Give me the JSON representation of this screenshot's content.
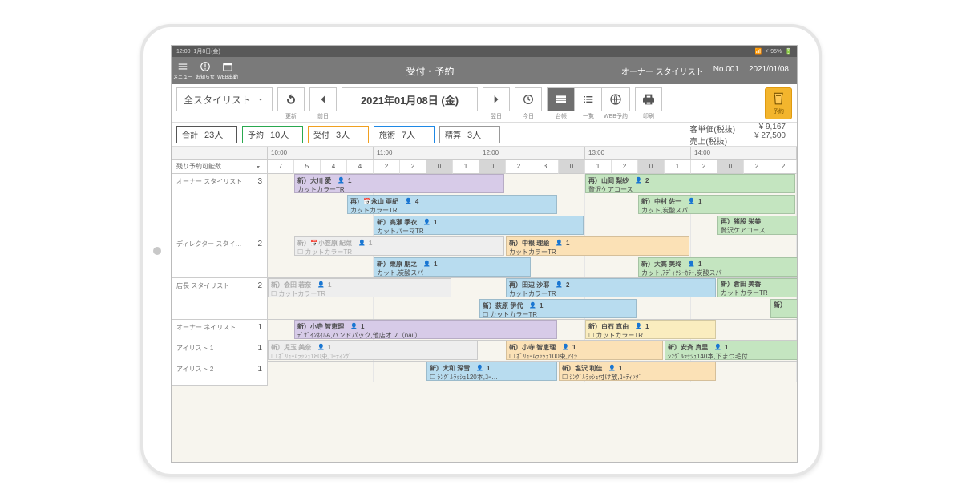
{
  "status": {
    "time": "12:00",
    "date": "1月8日(金)",
    "battery": "95%"
  },
  "appbar": {
    "menu": "メニュー",
    "notice": "お知らせ",
    "cal": "WEB出勤",
    "title": "受付・予約",
    "role": "オーナー スタイリスト",
    "no": "No.001",
    "date2": "2021/01/08"
  },
  "toolbar": {
    "stylist": "全スタイリスト",
    "refresh": "更新",
    "prev": "前日",
    "date": "2021年01月08日 (金)",
    "next": "翌日",
    "today": "今日",
    "ledger": "台帳",
    "list": "一覧",
    "web": "WEB予約",
    "print": "印刷",
    "reserve": "予約"
  },
  "stats": {
    "total_l": "合計",
    "total_v": "23人",
    "reserve_l": "予約",
    "reserve_v": "10人",
    "recep_l": "受付",
    "recep_v": "3人",
    "treat_l": "施術",
    "treat_v": "7人",
    "settle_l": "精算",
    "settle_v": "3人"
  },
  "sales": {
    "unit_l": "客単価(税抜)",
    "unit_v": "¥ 9,167",
    "sales_l": "売上(税抜)",
    "sales_v": "¥ 27,500"
  },
  "hours": [
    "10:00",
    "11:00",
    "12:00",
    "13:00",
    "14:00"
  ],
  "avail": {
    "label": "残り予約可能数",
    "nums": [
      "7",
      "5",
      "4",
      "4",
      "2",
      "2",
      "0",
      "1",
      "0",
      "2",
      "3",
      "0",
      "1",
      "2",
      "0",
      "1",
      "2",
      "0",
      "2",
      "2"
    ]
  },
  "staff": [
    {
      "name": "オーナー スタイリスト",
      "count": "3"
    },
    {
      "name": "ディレクター スタイ…",
      "count": "2"
    },
    {
      "name": "店長 スタイリスト",
      "count": "2"
    },
    {
      "name": "オーナー ネイリスト",
      "count": "1"
    },
    {
      "name": "アイリスト 1",
      "count": "1"
    },
    {
      "name": "アイリスト 2",
      "count": "1"
    }
  ],
  "appts": [
    {
      "staff": 0,
      "sub": 0,
      "start": 0.25,
      "dur": 2.0,
      "c": "purple",
      "tag": "新）",
      "name": "大川 愛",
      "p": "1",
      "svc": "カットカラーTR"
    },
    {
      "staff": 0,
      "sub": 0,
      "start": 3.0,
      "dur": 2.0,
      "c": "green",
      "tag": "再）",
      "name": "山岡 梨紗",
      "p": "2",
      "svc": "贅沢ケアコース"
    },
    {
      "staff": 0,
      "sub": 1,
      "start": 0.75,
      "dur": 2.0,
      "c": "blue",
      "tag": "再）📅",
      "name": "永山 亜紀",
      "p": "4",
      "svc": "カットカラーTR"
    },
    {
      "staff": 0,
      "sub": 1,
      "start": 3.5,
      "dur": 1.5,
      "c": "green",
      "tag": "新）",
      "name": "中村 佐一",
      "p": "1",
      "svc": "カット,炭酸スパ"
    },
    {
      "staff": 0,
      "sub": 2,
      "start": 1.0,
      "dur": 2.0,
      "c": "blue",
      "tag": "新）",
      "name": "高瀬 季衣",
      "p": "1",
      "svc": "カットパーマTR"
    },
    {
      "staff": 0,
      "sub": 2,
      "start": 4.25,
      "dur": 1.0,
      "c": "green",
      "tag": "再）",
      "name": "猪股 栄美",
      "p": "",
      "svc": "贅沢ケアコース"
    },
    {
      "staff": 1,
      "sub": 0,
      "start": 0.25,
      "dur": 2.0,
      "c": "gray",
      "tag": "新）📅",
      "name": "小笠原 紀菜",
      "p": "1",
      "svc": "☐ カットカラーTR"
    },
    {
      "staff": 1,
      "sub": 0,
      "start": 2.25,
      "dur": 1.75,
      "c": "orange",
      "tag": "新）",
      "name": "中根 理絵",
      "p": "1",
      "svc": "カットカラーTR"
    },
    {
      "staff": 1,
      "sub": 1,
      "start": 1.0,
      "dur": 1.5,
      "c": "blue",
      "tag": "新）",
      "name": "栗原 朋之",
      "p": "1",
      "svc": "カット,炭酸スパ"
    },
    {
      "staff": 1,
      "sub": 1,
      "start": 3.5,
      "dur": 1.75,
      "c": "green",
      "tag": "新）",
      "name": "大高 美玲",
      "p": "1",
      "svc": "カット,ｱﾃﾞｨｸｼｰｶﾗｰ,炭酸スパ"
    },
    {
      "staff": 2,
      "sub": 0,
      "start": 0.0,
      "dur": 1.75,
      "c": "gray",
      "tag": "新）",
      "name": "会田 若奈",
      "p": "1",
      "svc": "☐ カットカラーTR"
    },
    {
      "staff": 2,
      "sub": 0,
      "start": 2.25,
      "dur": 2.0,
      "c": "blue",
      "tag": "再）",
      "name": "田辺 沙耶",
      "p": "2",
      "svc": "カットカラーTR"
    },
    {
      "staff": 2,
      "sub": 0,
      "start": 4.25,
      "dur": 1.0,
      "c": "green",
      "tag": "新）",
      "name": "倉田 美香",
      "p": "",
      "svc": "カットカラーTR"
    },
    {
      "staff": 2,
      "sub": 1,
      "start": 2.0,
      "dur": 1.5,
      "c": "blue",
      "tag": "新）",
      "name": "荻原 伊代",
      "p": "1",
      "svc": "☐ カットカラーTR"
    },
    {
      "staff": 2,
      "sub": 1,
      "start": 4.75,
      "dur": 0.5,
      "c": "green",
      "tag": "新）",
      "name": "",
      "p": "",
      "svc": ""
    },
    {
      "staff": 3,
      "sub": 0,
      "start": 0.25,
      "dur": 2.5,
      "c": "purple",
      "tag": "新）",
      "name": "小寺 智恵理",
      "p": "1",
      "svc": "ﾃﾞｻﾞｲﾝﾈｲﾙA,ハンドパック,他店オフ（nail）"
    },
    {
      "staff": 3,
      "sub": 0,
      "start": 3.0,
      "dur": 1.25,
      "c": "yellow",
      "tag": "新）",
      "name": "白石 真由",
      "p": "1",
      "svc": "☐ カットカラーTR"
    },
    {
      "staff": 4,
      "sub": 0,
      "start": 0.0,
      "dur": 2.0,
      "c": "gray",
      "tag": "新）",
      "name": "児玉 美奈",
      "p": "1",
      "svc": "☐ ﾎﾞﾘｭｰﾑﾗｯｼｭ180束,ｺｰﾃｨﾝｸﾞ"
    },
    {
      "staff": 4,
      "sub": 0,
      "start": 2.25,
      "dur": 1.5,
      "c": "orange",
      "tag": "新）",
      "name": "小寺 智恵理",
      "p": "1",
      "svc": "☐ ﾎﾞﾘｭｰﾑﾗｯｼｭ100束,ｱｲｼ…"
    },
    {
      "staff": 4,
      "sub": 0,
      "start": 3.75,
      "dur": 1.5,
      "c": "green",
      "tag": "新）",
      "name": "安斉 真里",
      "p": "1",
      "svc": "ｼﾝｸﾞﾙﾗｯｼｭ140本,下まつ毛付"
    },
    {
      "staff": 5,
      "sub": 0,
      "start": 1.5,
      "dur": 1.25,
      "c": "blue",
      "tag": "新）",
      "name": "大和 深雪",
      "p": "1",
      "svc": "☐ ｼﾝｸﾞﾙﾗｯｼｭ120本,ｺｰ…"
    },
    {
      "staff": 5,
      "sub": 0,
      "start": 2.75,
      "dur": 1.5,
      "c": "orange",
      "tag": "新）",
      "name": "塩沢 利佳",
      "p": "1",
      "svc": "☐ ｼﾝｸﾞﾙﾗｯｼｭ付け放,ｺｰﾃｨﾝｸﾞ"
    }
  ]
}
